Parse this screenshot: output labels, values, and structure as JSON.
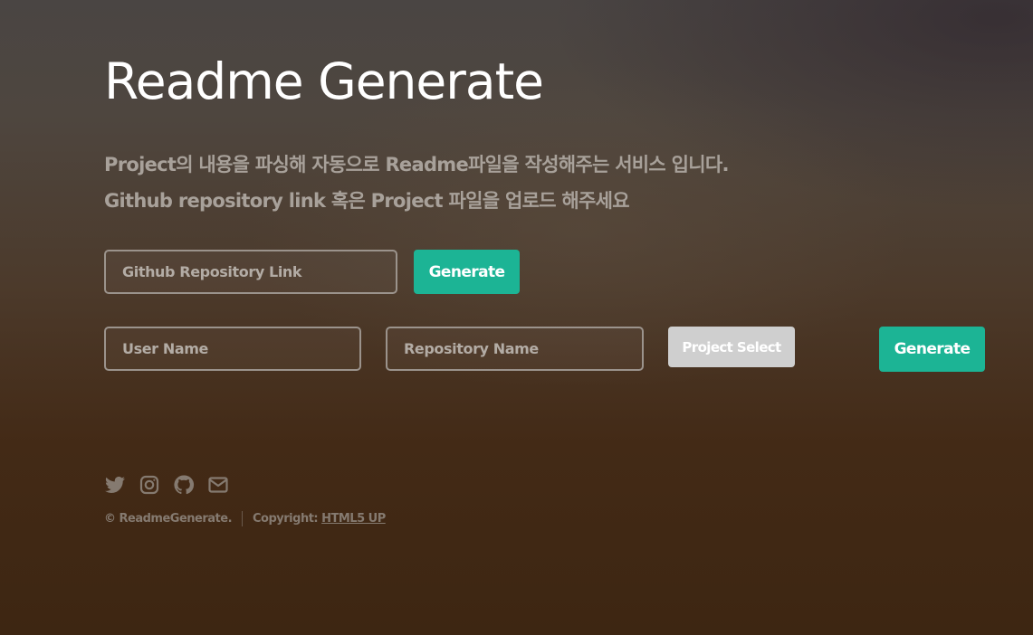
{
  "header": {
    "title": "Readme Generate",
    "description_line1": "Project의 내용을 파싱해 자동으로 Readme파일을 작성해주는 서비스 입니다.",
    "description_line2": "Github repository link 혹은 Project 파일을 업로드 해주세요"
  },
  "link_form": {
    "repo_link_placeholder": "Github Repository Link",
    "repo_link_value": "",
    "generate_label": "Generate"
  },
  "upload_form": {
    "user_name_placeholder": "User Name",
    "user_name_value": "",
    "repo_name_placeholder": "Repository Name",
    "repo_name_value": "",
    "project_select_label": "Project Select",
    "generate_label": "Generate"
  },
  "social": [
    {
      "icon": "twitter-icon"
    },
    {
      "icon": "instagram-icon"
    },
    {
      "icon": "github-icon"
    },
    {
      "icon": "mail-icon"
    }
  ],
  "footer": {
    "copyright": "© ReadmeGenerate.",
    "credit_prefix": "Copyright:",
    "credit_link": "HTML5 UP"
  },
  "colors": {
    "accent": "#1cb495",
    "button_disabled": "#cfcfcf",
    "heading": "#ffffff",
    "muted_text": "#a8a19a"
  }
}
